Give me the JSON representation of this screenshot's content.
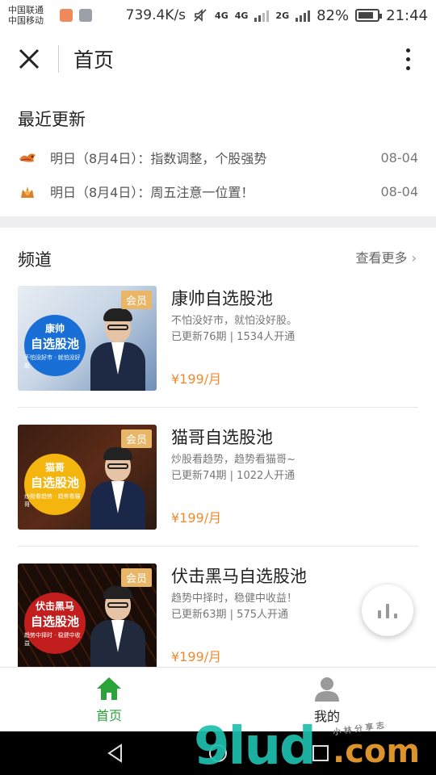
{
  "status_bar": {
    "carrier_1": "中国联通",
    "carrier_2": "中国移动",
    "speed": "739.4K/s",
    "network_1": "4G",
    "network_2": "4G",
    "network_3": "2G",
    "battery": "82%",
    "battery_level": 0.82,
    "time": "21:44"
  },
  "header": {
    "close_icon": "close-icon",
    "title": "首页",
    "more_icon": "more-vertical-icon"
  },
  "recent": {
    "title": "最近更新",
    "items": [
      {
        "icon": "dragon-icon",
        "text": "明日（8月4日）：指数调整，个股强势",
        "date": "08-04"
      },
      {
        "icon": "lion-icon",
        "text": "明日（8月4日）：周五注意一位置！",
        "date": "08-04"
      }
    ]
  },
  "channels": {
    "title": "频道",
    "see_more": "查看更多",
    "items": [
      {
        "name": "康帅自选股池",
        "desc": "不怕没好市，就怕没好股。",
        "stats": "已更新76期 | 1534人开通",
        "price": "¥199/月",
        "badge": "会员",
        "cover_line1": "康帅",
        "cover_line2": "自选股池",
        "cover_line3": "不怕没好市 · 就怕没好股",
        "cover_color": "#1a6fd6"
      },
      {
        "name": "猫哥自选股池",
        "desc": "炒股看趋势，趋势看猫哥~",
        "stats": "已更新74期 | 1022人开通",
        "price": "¥199/月",
        "badge": "会员",
        "cover_line1": "猫哥",
        "cover_line2": "自选股池",
        "cover_line3": "炒股看趋势 · 趋势看猫哥",
        "cover_color": "#f5b50f"
      },
      {
        "name": "伏击黑马自选股池",
        "desc": "趋势中择时，稳健中收益！",
        "stats": "已更新63期 | 575人开通",
        "price": "¥199/月",
        "badge": "会员",
        "cover_line1": "伏击黑马",
        "cover_line2": "自选股池",
        "cover_line3": "趋势中择时 · 稳健中收益",
        "cover_color": "#c21e1e"
      }
    ]
  },
  "tabbar": {
    "tabs": [
      {
        "label": "首页",
        "icon": "home-icon",
        "active": true
      },
      {
        "label": "我的",
        "icon": "user-icon",
        "active": false
      }
    ]
  },
  "colors": {
    "accent_green": "#2aa43a",
    "price_orange": "#f08a2e",
    "badge_gold": "#e9b668"
  },
  "watermark": {
    "brand": "9lud",
    "domain": ".com",
    "small": "小 林 分 享 志"
  }
}
